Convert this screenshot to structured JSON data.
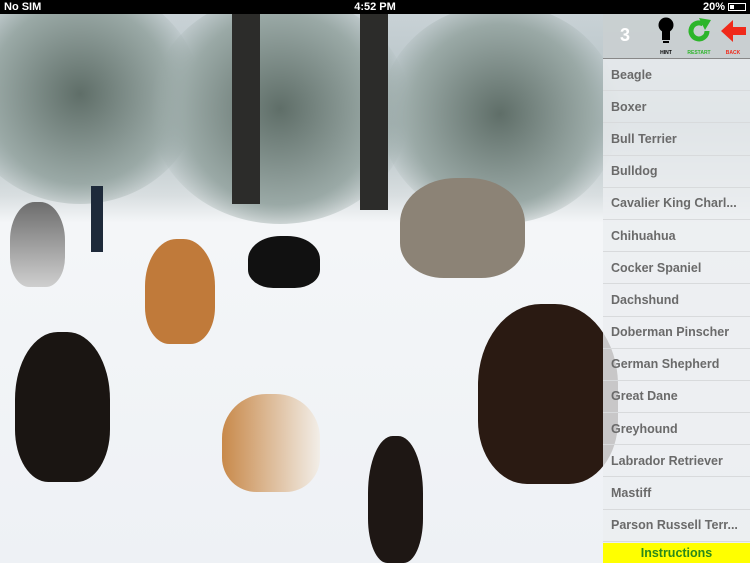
{
  "status": {
    "carrier": "No SIM",
    "time": "4:52 PM",
    "battery": "20%"
  },
  "game": {
    "count": "3",
    "hint_label": "HINT",
    "restart_label": "RESTART",
    "back_label": "BACK"
  },
  "breeds": [
    "Beagle",
    "Boxer",
    "Bull Terrier",
    "Bulldog",
    "Cavalier King Charl...",
    "Chihuahua",
    "Cocker Spaniel",
    "Dachshund",
    "Doberman Pinscher",
    "German Shepherd",
    "Great Dane",
    "Greyhound",
    "Labrador Retriever",
    "Mastiff",
    "Parson Russell Terr..."
  ],
  "instructions_label": "Instructions"
}
